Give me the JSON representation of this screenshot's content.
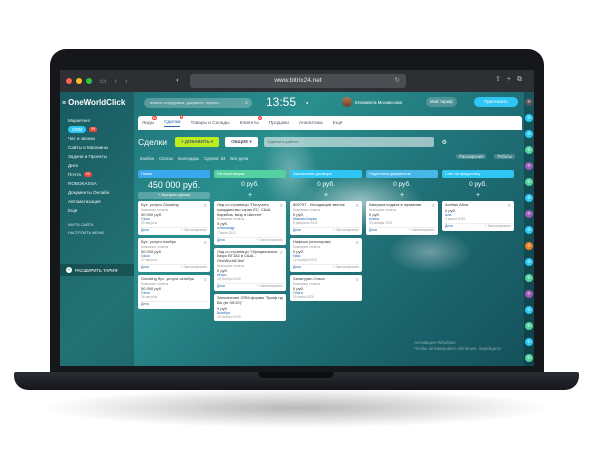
{
  "colors": {
    "accent": "#2fc6f6",
    "green_button": "#bbed21",
    "laptop": "#15171b"
  },
  "browser": {
    "url": "www.bitrix24.net"
  },
  "app": {
    "logo": "OneWorldClick",
    "search_placeholder": "искать сотрудника, документ, прочее...",
    "clock": "13:55",
    "user_name": "Елизавета Москвесова",
    "tariff": "Мой тариф",
    "invite": "Пригласить"
  },
  "sidebar": {
    "items": [
      {
        "label": "Маркетинг"
      },
      {
        "label": "CRM",
        "badge": "99"
      },
      {
        "label": "Чат и звонки"
      },
      {
        "label": "Сайты и Магазины"
      },
      {
        "label": "Задачи и Проекты"
      },
      {
        "label": "Диск"
      },
      {
        "label": "Почта",
        "badge": "22"
      },
      {
        "label": "ROBOKASSA"
      },
      {
        "label": "Документы Онлайн"
      },
      {
        "label": "Автоматизация"
      },
      {
        "label": "Ещё"
      }
    ],
    "small": [
      "КАРТА САЙТА",
      "НАСТРОИТЬ МЕНЮ"
    ],
    "expand": "РАСШИРИТЬ ТАРИФ"
  },
  "tabs": [
    {
      "label": "Лиды",
      "badge": "99"
    },
    {
      "label": "Сделки",
      "badge": "6",
      "active": true
    },
    {
      "label": "Товары и Склады"
    },
    {
      "label": "Клиенты",
      "badge": "2"
    },
    {
      "label": "Продажи"
    },
    {
      "label": "Аналитика"
    },
    {
      "label": "Ещё"
    }
  ],
  "toolbar": {
    "title": "Сделки",
    "add": "ДОБАВИТЬ",
    "general": "ОБЩИЕ",
    "filter": "Сделки в работе"
  },
  "views": {
    "left": [
      "Канбан",
      "Список",
      "Календарь",
      "Сделки: 53",
      "Все дела"
    ],
    "right": [
      "Расширения",
      "Роботы"
    ]
  },
  "columns": [
    {
      "title": "Новая",
      "color": "#39a8ef",
      "sum": "450 000 руб.",
      "quick": "+ Быстрая сделка",
      "cards": [
        {
          "title": "Бух. услуги Glooking",
          "sub": "Компания оплаты",
          "price": "30 000 руб.",
          "contact": "Glooc",
          "date": "25 августа",
          "foot": "Дела",
          "plan": "+ Запланировать"
        },
        {
          "title": "Бух. услуги ноябрь",
          "sub": "Компания оплаты",
          "price": "50 000 руб.",
          "contact": "Glooc",
          "date": "27 августа",
          "foot": "Дела",
          "plan": "+ Запланировать"
        },
        {
          "title": "Glooking бух. услуги октябрь",
          "sub": "Компания оплаты",
          "price": "50 000 руб.",
          "contact": "Glooc",
          "date": "26 августа",
          "foot": "Дела",
          "plan": ""
        }
      ]
    },
    {
      "title": "На переговорах",
      "color": "#55d0a0",
      "sum": "0 руб.",
      "cards": [
        {
          "title": "Лид со страницы \"Получить гражданство стран ЕС, США, Карибов, визу в Шенген\"",
          "sub": "Компания оплаты",
          "price": "0 руб.",
          "contact": "Александр",
          "date": "7 июня 2021",
          "foot": "Дела",
          "plan": "+ Запланировать"
        },
        {
          "title": "Лид со страницы \"Официальное Бюро ВТ182 в США - OneWorldClick\"",
          "sub": "Компания оплаты",
          "price": "0 руб.",
          "contact": "Игорь",
          "date": "16 ноября 2020",
          "foot": "Дела",
          "plan": "+ Запланировать"
        },
        {
          "title": "Заполнение CRM-формы \"Бриф на ВА (вт 09:20)\"",
          "sub": "",
          "price": "0 руб.",
          "contact": "Шелбри",
          "date": "25 ноября 2020",
          "foot": "",
          "plan": ""
        }
      ]
    },
    {
      "title": "Заключение договора",
      "color": "#2fc6f6",
      "sum": "0 руб.",
      "cards": [
        {
          "title": "800797 - Исходящий звонок",
          "sub": "Компания оплаты",
          "price": "0 руб.",
          "contact": "Максим Бирюк",
          "date": "9 февраля 2021",
          "foot": "Дела",
          "plan": "+ Запланировать"
        },
        {
          "title": "Нафиса (инстаграм)",
          "sub": "Компания оплаты",
          "price": "0 руб.",
          "contact": "Наф",
          "date": "12 ноября 2020",
          "foot": "Дела",
          "plan": "+ Запланировать"
        },
        {
          "title": "Хачатурян Ольга",
          "sub": "Компания оплаты",
          "price": "0 руб.",
          "contact": "Ольга",
          "date": "29 июня 2020",
          "foot": "",
          "plan": ""
        }
      ]
    },
    {
      "title": "Подготовка документов",
      "color": "#47b7e8",
      "sum": "0 руб.",
      "cards": [
        {
          "title": "Америка подача в германии",
          "sub": "Компания оплаты",
          "price": "0 руб.",
          "contact": "Алина",
          "date": "29 января 2021",
          "foot": "Дела",
          "plan": "+ Запланировать"
        }
      ]
    },
    {
      "title": "Счёт на предоплату",
      "color": "#2fc6f6",
      "sum": "0 руб.",
      "cards": [
        {
          "title": "Avetian Alina",
          "sub": "",
          "price": "0 руб.",
          "contact": "Ала",
          "date": "4 марта 2020",
          "foot": "Дела",
          "plan": "+ Запланировать"
        }
      ]
    }
  ],
  "watermark": [
    "Активация Windows",
    "Чтобы активировать Windows, перейдите"
  ]
}
